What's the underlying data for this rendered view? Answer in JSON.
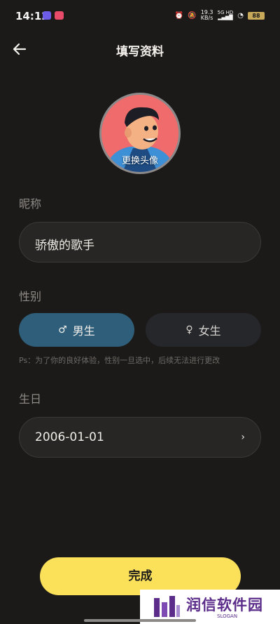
{
  "status_bar": {
    "time": "14:12",
    "net_speed_value": "19.3",
    "net_speed_unit": "KB/s",
    "net_type": "5G HD",
    "battery": "88"
  },
  "header": {
    "title": "填写资料"
  },
  "avatar": {
    "caption": "更换头像"
  },
  "nickname": {
    "label": "昵称",
    "value": "骄傲的歌手"
  },
  "gender": {
    "label": "性别",
    "options": [
      {
        "label": "男生",
        "symbol": "♂",
        "selected": true
      },
      {
        "label": "女生",
        "symbol": "♀",
        "selected": false
      }
    ],
    "note": "Ps：为了你的良好体验，性别一旦选中，后续无法进行更改"
  },
  "birthday": {
    "label": "生日",
    "value": "2006-01-01",
    "chevron": "›"
  },
  "actions": {
    "done_label": "完成"
  },
  "watermark": {
    "text": "润信软件园",
    "slogan": "SLOGAN"
  },
  "colors": {
    "accent": "#fbe15a",
    "male_selected": "#2e5e79",
    "background": "#1c1a19"
  }
}
